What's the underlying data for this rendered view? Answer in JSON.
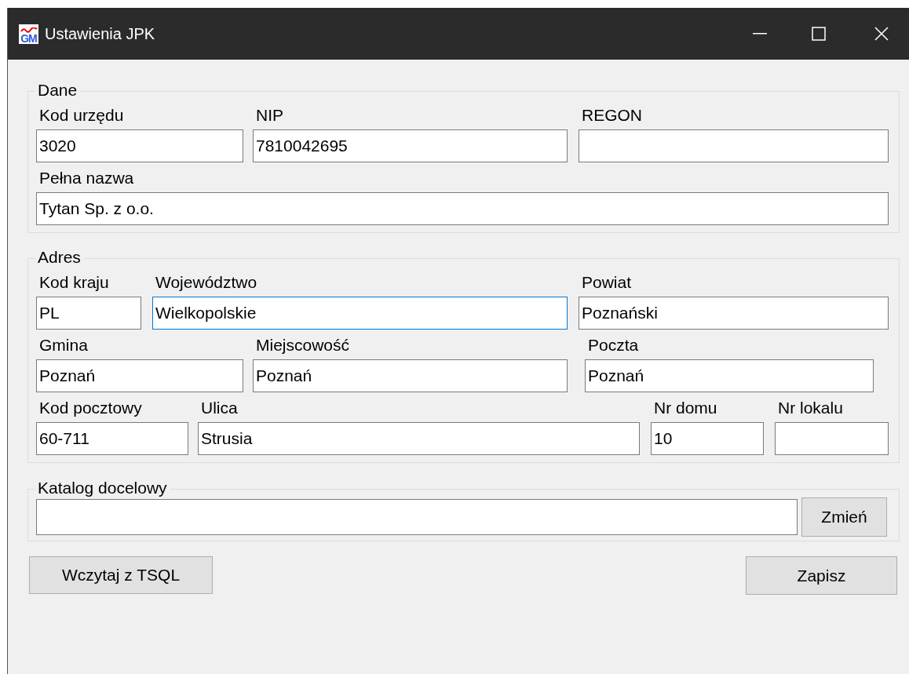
{
  "window": {
    "title": "Ustawienia JPK",
    "icon_text": "GM"
  },
  "groups": [
    {
      "title": "Dane",
      "rows": [
        [
          {
            "label": "Kod urzędu",
            "value": "3020",
            "focused": false
          },
          {
            "label": "NIP",
            "value": "7810042695",
            "focused": false
          },
          {
            "label": "REGON",
            "focused": false
          }
        ],
        [
          {
            "label": "Pełna nazwa",
            "value": "Tytan Sp. z o.o.",
            "focused": false
          }
        ]
      ]
    },
    {
      "title": "Adres",
      "rows": [
        [
          {
            "label": "Kod kraju",
            "value": "PL",
            "focused": false
          },
          {
            "label": "Województwo",
            "value": "Wielkopolskie",
            "focused": true
          },
          {
            "label": "Powiat",
            "value": "Poznański",
            "focused": false
          }
        ],
        [
          {
            "label": "Gmina",
            "value": "Poznań",
            "focused": false
          },
          {
            "label": "Miejscowość",
            "value": "Poznań",
            "focused": false
          },
          {
            "label": "Poczta",
            "value": "Poznań",
            "focused": false
          }
        ],
        [
          {
            "label": "Kod pocztowy",
            "value": "60-711",
            "focused": false
          },
          {
            "label": "Ulica",
            "value": "Strusia",
            "focused": false
          },
          {
            "label": "Nr domu",
            "value": "10",
            "focused": false
          },
          {
            "label": "Nr lokalu",
            "focused": false
          }
        ]
      ]
    }
  ],
  "target_folder": {
    "title": "Katalog docelowy",
    "button": "Zmień"
  },
  "buttons": [
    "Wczytaj z TSQL",
    "Zapisz"
  ]
}
